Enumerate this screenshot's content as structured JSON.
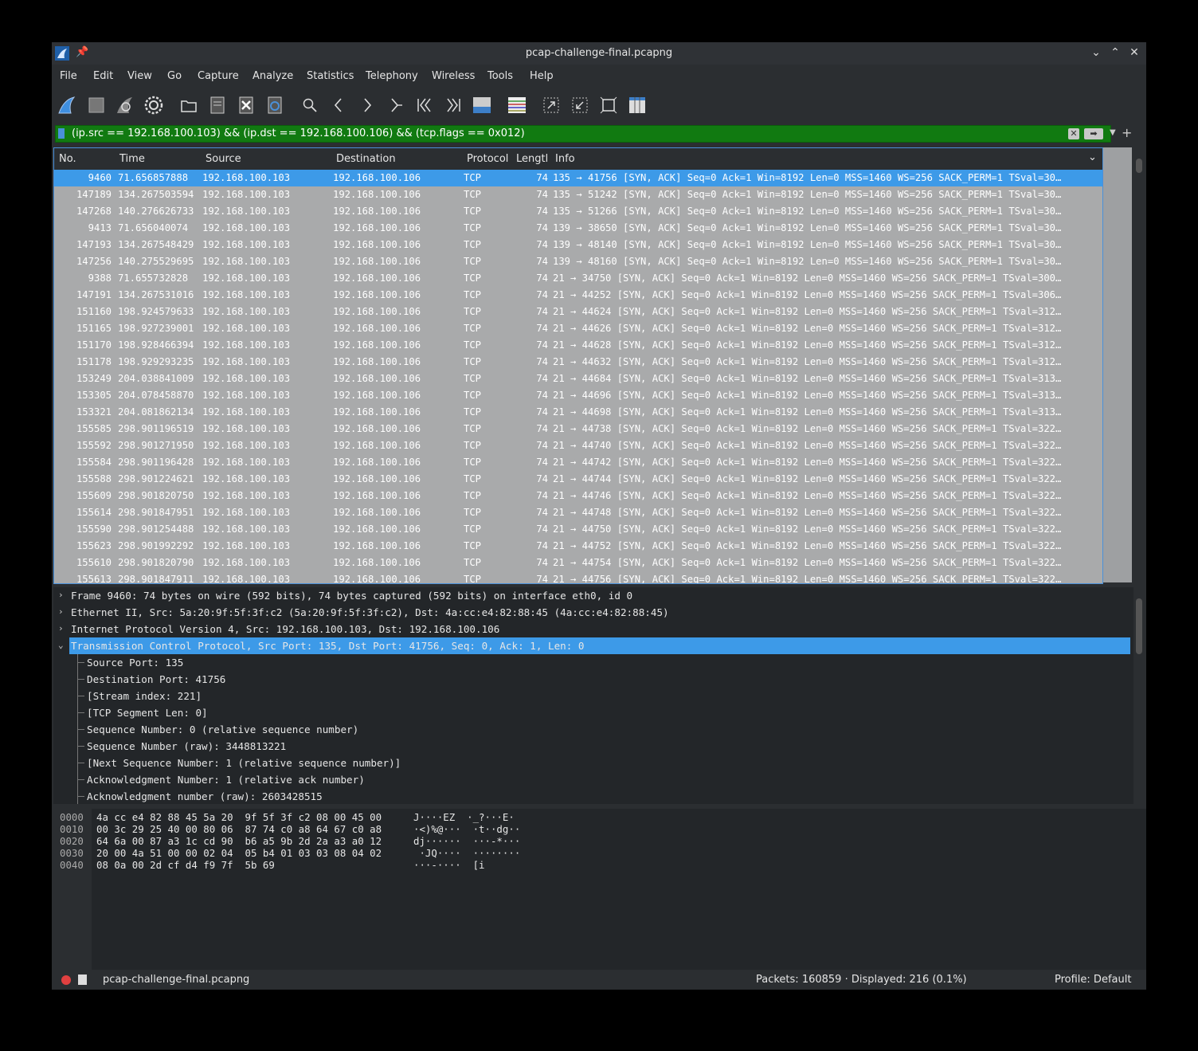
{
  "window": {
    "title": "pcap-challenge-final.pcapng"
  },
  "menu": [
    "File",
    "Edit",
    "View",
    "Go",
    "Capture",
    "Analyze",
    "Statistics",
    "Telephony",
    "Wireless",
    "Tools",
    "Help"
  ],
  "toolbar_icons": [
    "shark-fin-start-icon",
    "stop-icon",
    "restart-icon",
    "options-gear-icon",
    "open-folder-icon",
    "save-file-icon",
    "close-file-icon",
    "reload-icon",
    "find-icon",
    "back-icon",
    "forward-icon",
    "goto-icon",
    "first-packet-icon",
    "last-packet-icon",
    "autoscroll-icon",
    "colorize-icon",
    "zoom-in-icon",
    "zoom-out-icon",
    "normal-size-icon",
    "resize-columns-icon"
  ],
  "filter": {
    "expression": "(ip.src == 192.168.100.103) && (ip.dst == 192.168.100.106) && (tcp.flags == 0x012)"
  },
  "columns": [
    "No.",
    "Time",
    "Source",
    "Destination",
    "Protocol",
    "Lengtl",
    "Info"
  ],
  "packets": [
    {
      "no": "9460",
      "time": "71.656857888",
      "src": "192.168.100.103",
      "dst": "192.168.100.106",
      "proto": "TCP",
      "len": "74",
      "info": "135 → 41756 [SYN, ACK] Seq=0 Ack=1 Win=8192 Len=0 MSS=1460 WS=256 SACK_PERM=1 TSval=30…"
    },
    {
      "no": "147189",
      "time": "134.267503594",
      "src": "192.168.100.103",
      "dst": "192.168.100.106",
      "proto": "TCP",
      "len": "74",
      "info": "135 → 51242 [SYN, ACK] Seq=0 Ack=1 Win=8192 Len=0 MSS=1460 WS=256 SACK_PERM=1 TSval=30…"
    },
    {
      "no": "147268",
      "time": "140.276626733",
      "src": "192.168.100.103",
      "dst": "192.168.100.106",
      "proto": "TCP",
      "len": "74",
      "info": "135 → 51266 [SYN, ACK] Seq=0 Ack=1 Win=8192 Len=0 MSS=1460 WS=256 SACK_PERM=1 TSval=30…"
    },
    {
      "no": "9413",
      "time": "71.656040074",
      "src": "192.168.100.103",
      "dst": "192.168.100.106",
      "proto": "TCP",
      "len": "74",
      "info": "139 → 38650 [SYN, ACK] Seq=0 Ack=1 Win=8192 Len=0 MSS=1460 WS=256 SACK_PERM=1 TSval=30…"
    },
    {
      "no": "147193",
      "time": "134.267548429",
      "src": "192.168.100.103",
      "dst": "192.168.100.106",
      "proto": "TCP",
      "len": "74",
      "info": "139 → 48140 [SYN, ACK] Seq=0 Ack=1 Win=8192 Len=0 MSS=1460 WS=256 SACK_PERM=1 TSval=30…"
    },
    {
      "no": "147256",
      "time": "140.275529695",
      "src": "192.168.100.103",
      "dst": "192.168.100.106",
      "proto": "TCP",
      "len": "74",
      "info": "139 → 48160 [SYN, ACK] Seq=0 Ack=1 Win=8192 Len=0 MSS=1460 WS=256 SACK_PERM=1 TSval=30…"
    },
    {
      "no": "9388",
      "time": "71.655732828",
      "src": "192.168.100.103",
      "dst": "192.168.100.106",
      "proto": "TCP",
      "len": "74",
      "info": "21 → 34750 [SYN, ACK] Seq=0 Ack=1 Win=8192 Len=0 MSS=1460 WS=256 SACK_PERM=1 TSval=300…"
    },
    {
      "no": "147191",
      "time": "134.267531016",
      "src": "192.168.100.103",
      "dst": "192.168.100.106",
      "proto": "TCP",
      "len": "74",
      "info": "21 → 44252 [SYN, ACK] Seq=0 Ack=1 Win=8192 Len=0 MSS=1460 WS=256 SACK_PERM=1 TSval=306…"
    },
    {
      "no": "151160",
      "time": "198.924579633",
      "src": "192.168.100.103",
      "dst": "192.168.100.106",
      "proto": "TCP",
      "len": "74",
      "info": "21 → 44624 [SYN, ACK] Seq=0 Ack=1 Win=8192 Len=0 MSS=1460 WS=256 SACK_PERM=1 TSval=312…"
    },
    {
      "no": "151165",
      "time": "198.927239001",
      "src": "192.168.100.103",
      "dst": "192.168.100.106",
      "proto": "TCP",
      "len": "74",
      "info": "21 → 44626 [SYN, ACK] Seq=0 Ack=1 Win=8192 Len=0 MSS=1460 WS=256 SACK_PERM=1 TSval=312…"
    },
    {
      "no": "151170",
      "time": "198.928466394",
      "src": "192.168.100.103",
      "dst": "192.168.100.106",
      "proto": "TCP",
      "len": "74",
      "info": "21 → 44628 [SYN, ACK] Seq=0 Ack=1 Win=8192 Len=0 MSS=1460 WS=256 SACK_PERM=1 TSval=312…"
    },
    {
      "no": "151178",
      "time": "198.929293235",
      "src": "192.168.100.103",
      "dst": "192.168.100.106",
      "proto": "TCP",
      "len": "74",
      "info": "21 → 44632 [SYN, ACK] Seq=0 Ack=1 Win=8192 Len=0 MSS=1460 WS=256 SACK_PERM=1 TSval=312…"
    },
    {
      "no": "153249",
      "time": "204.038841009",
      "src": "192.168.100.103",
      "dst": "192.168.100.106",
      "proto": "TCP",
      "len": "74",
      "info": "21 → 44684 [SYN, ACK] Seq=0 Ack=1 Win=8192 Len=0 MSS=1460 WS=256 SACK_PERM=1 TSval=313…"
    },
    {
      "no": "153305",
      "time": "204.078458870",
      "src": "192.168.100.103",
      "dst": "192.168.100.106",
      "proto": "TCP",
      "len": "74",
      "info": "21 → 44696 [SYN, ACK] Seq=0 Ack=1 Win=8192 Len=0 MSS=1460 WS=256 SACK_PERM=1 TSval=313…"
    },
    {
      "no": "153321",
      "time": "204.081862134",
      "src": "192.168.100.103",
      "dst": "192.168.100.106",
      "proto": "TCP",
      "len": "74",
      "info": "21 → 44698 [SYN, ACK] Seq=0 Ack=1 Win=8192 Len=0 MSS=1460 WS=256 SACK_PERM=1 TSval=313…"
    },
    {
      "no": "155585",
      "time": "298.901196519",
      "src": "192.168.100.103",
      "dst": "192.168.100.106",
      "proto": "TCP",
      "len": "74",
      "info": "21 → 44738 [SYN, ACK] Seq=0 Ack=1 Win=8192 Len=0 MSS=1460 WS=256 SACK_PERM=1 TSval=322…"
    },
    {
      "no": "155592",
      "time": "298.901271950",
      "src": "192.168.100.103",
      "dst": "192.168.100.106",
      "proto": "TCP",
      "len": "74",
      "info": "21 → 44740 [SYN, ACK] Seq=0 Ack=1 Win=8192 Len=0 MSS=1460 WS=256 SACK_PERM=1 TSval=322…"
    },
    {
      "no": "155584",
      "time": "298.901196428",
      "src": "192.168.100.103",
      "dst": "192.168.100.106",
      "proto": "TCP",
      "len": "74",
      "info": "21 → 44742 [SYN, ACK] Seq=0 Ack=1 Win=8192 Len=0 MSS=1460 WS=256 SACK_PERM=1 TSval=322…"
    },
    {
      "no": "155588",
      "time": "298.901224621",
      "src": "192.168.100.103",
      "dst": "192.168.100.106",
      "proto": "TCP",
      "len": "74",
      "info": "21 → 44744 [SYN, ACK] Seq=0 Ack=1 Win=8192 Len=0 MSS=1460 WS=256 SACK_PERM=1 TSval=322…"
    },
    {
      "no": "155609",
      "time": "298.901820750",
      "src": "192.168.100.103",
      "dst": "192.168.100.106",
      "proto": "TCP",
      "len": "74",
      "info": "21 → 44746 [SYN, ACK] Seq=0 Ack=1 Win=8192 Len=0 MSS=1460 WS=256 SACK_PERM=1 TSval=322…"
    },
    {
      "no": "155614",
      "time": "298.901847951",
      "src": "192.168.100.103",
      "dst": "192.168.100.106",
      "proto": "TCP",
      "len": "74",
      "info": "21 → 44748 [SYN, ACK] Seq=0 Ack=1 Win=8192 Len=0 MSS=1460 WS=256 SACK_PERM=1 TSval=322…"
    },
    {
      "no": "155590",
      "time": "298.901254488",
      "src": "192.168.100.103",
      "dst": "192.168.100.106",
      "proto": "TCP",
      "len": "74",
      "info": "21 → 44750 [SYN, ACK] Seq=0 Ack=1 Win=8192 Len=0 MSS=1460 WS=256 SACK_PERM=1 TSval=322…"
    },
    {
      "no": "155623",
      "time": "298.901992292",
      "src": "192.168.100.103",
      "dst": "192.168.100.106",
      "proto": "TCP",
      "len": "74",
      "info": "21 → 44752 [SYN, ACK] Seq=0 Ack=1 Win=8192 Len=0 MSS=1460 WS=256 SACK_PERM=1 TSval=322…"
    },
    {
      "no": "155610",
      "time": "298.901820790",
      "src": "192.168.100.103",
      "dst": "192.168.100.106",
      "proto": "TCP",
      "len": "74",
      "info": "21 → 44754 [SYN, ACK] Seq=0 Ack=1 Win=8192 Len=0 MSS=1460 WS=256 SACK_PERM=1 TSval=322…"
    },
    {
      "no": "155613",
      "time": "298.901847911",
      "src": "192.168.100.103",
      "dst": "192.168.100.106",
      "proto": "TCP",
      "len": "74",
      "info": "21 → 44756 [SYN, ACK] Seq=0 Ack=1 Win=8192 Len=0 MSS=1460 WS=256 SACK_PERM=1 TSval=322…"
    }
  ],
  "details": [
    {
      "text": "Frame 9460: 74 bytes on wire (592 bits), 74 bytes captured (592 bits) on interface eth0, id 0",
      "arrow": "›",
      "level": 0
    },
    {
      "text": "Ethernet II, Src: 5a:20:9f:5f:3f:c2 (5a:20:9f:5f:3f:c2), Dst: 4a:cc:e4:82:88:45 (4a:cc:e4:82:88:45)",
      "arrow": "›",
      "level": 0
    },
    {
      "text": "Internet Protocol Version 4, Src: 192.168.100.103, Dst: 192.168.100.106",
      "arrow": "›",
      "level": 0
    },
    {
      "text": "Transmission Control Protocol, Src Port: 135, Dst Port: 41756, Seq: 0, Ack: 1, Len: 0",
      "arrow": "⌄",
      "level": 0
    },
    {
      "text": "Source Port: 135",
      "arrow": "",
      "level": 1
    },
    {
      "text": "Destination Port: 41756",
      "arrow": "",
      "level": 1
    },
    {
      "text": "[Stream index: 221]",
      "arrow": "",
      "level": 1
    },
    {
      "text": "[TCP Segment Len: 0]",
      "arrow": "",
      "level": 1
    },
    {
      "text": "Sequence Number: 0    (relative sequence number)",
      "arrow": "",
      "level": 1
    },
    {
      "text": "Sequence Number (raw): 3448813221",
      "arrow": "",
      "level": 1
    },
    {
      "text": "[Next Sequence Number: 1    (relative sequence number)]",
      "arrow": "",
      "level": 1
    },
    {
      "text": "Acknowledgment Number: 1    (relative ack number)",
      "arrow": "",
      "level": 1
    },
    {
      "text": "Acknowledgment number (raw): 2603428515",
      "arrow": "",
      "level": 1
    }
  ],
  "bytes": [
    {
      "offset": "0000",
      "hex": "4a cc e4 82 88 45 5a 20  9f 5f 3f c2 08 00 45 00",
      "ascii": "J····EZ  ·_?···E·"
    },
    {
      "offset": "0010",
      "hex": "00 3c 29 25 40 00 80 06  87 74 c0 a8 64 67 c0 a8",
      "ascii": "·<)%@···  ·t··dg··"
    },
    {
      "offset": "0020",
      "hex": "64 6a 00 87 a3 1c cd 90  b6 a5 9b 2d 2a a3 a0 12",
      "ascii": "dj······  ···-*···"
    },
    {
      "offset": "0030",
      "hex": "20 00 4a 51 00 00 02 04  05 b4 01 03 03 08 04 02",
      "ascii": " ·JQ····  ········"
    },
    {
      "offset": "0040",
      "hex": "08 0a 00 2d cf d4 f9 7f  5b 69",
      "ascii": "···-····  [i"
    }
  ],
  "status": {
    "file": "pcap-challenge-final.pcapng",
    "packets": "Packets: 160859 · Displayed: 216 (0.1%)",
    "profile": "Profile: Default"
  }
}
